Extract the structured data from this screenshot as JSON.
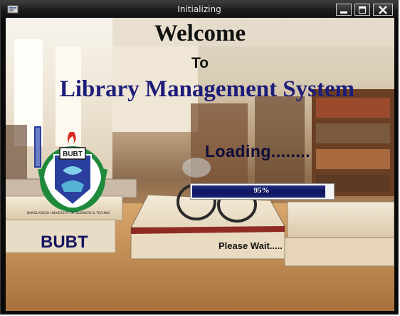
{
  "window": {
    "title": "Initializing"
  },
  "splash": {
    "welcome": "Welcome",
    "to": "To",
    "system_name": "Library Management System",
    "org_short": "BUBT",
    "logo_text": "BANGLADESH UNIVERSITY OF BUSINESS & TECHNOLOGY",
    "loading": "Loading........",
    "wait": "Please Wait....."
  },
  "progress": {
    "value": 0.95,
    "label": "95%"
  },
  "colors": {
    "title_navy": "#1c1c7a",
    "progress_fill": "#0d1460",
    "logo_green": "#1f8a3c",
    "logo_blue": "#2a3f9e"
  },
  "icons": [
    "app-icon",
    "minimize-icon",
    "maximize-icon",
    "close-icon"
  ]
}
